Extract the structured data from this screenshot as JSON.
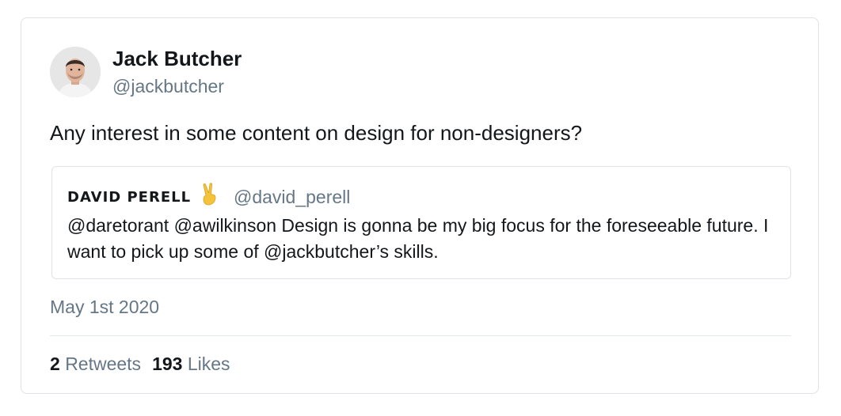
{
  "tweet": {
    "author_name": "Jack Butcher",
    "author_handle": "@jackbutcher",
    "text": "Any interest in some content on design for non-designers?",
    "date": "May 1st 2020",
    "retweet_count": "2",
    "retweet_label": "Retweets",
    "like_count": "193",
    "like_label": "Likes"
  },
  "quoted_tweet": {
    "author_name": "DAVID PERELL",
    "author_emoji": "victory-hand-icon",
    "author_handle": "@david_perell",
    "text": "@daretorant @awilkinson Design is gonna be my big focus for the foreseeable future. I want to pick up some of @jackbutcher’s skills."
  },
  "colors": {
    "primary_text": "#14171a",
    "secondary_text": "#657786",
    "border": "#dfe3e8",
    "emoji": "#f5c33b"
  }
}
